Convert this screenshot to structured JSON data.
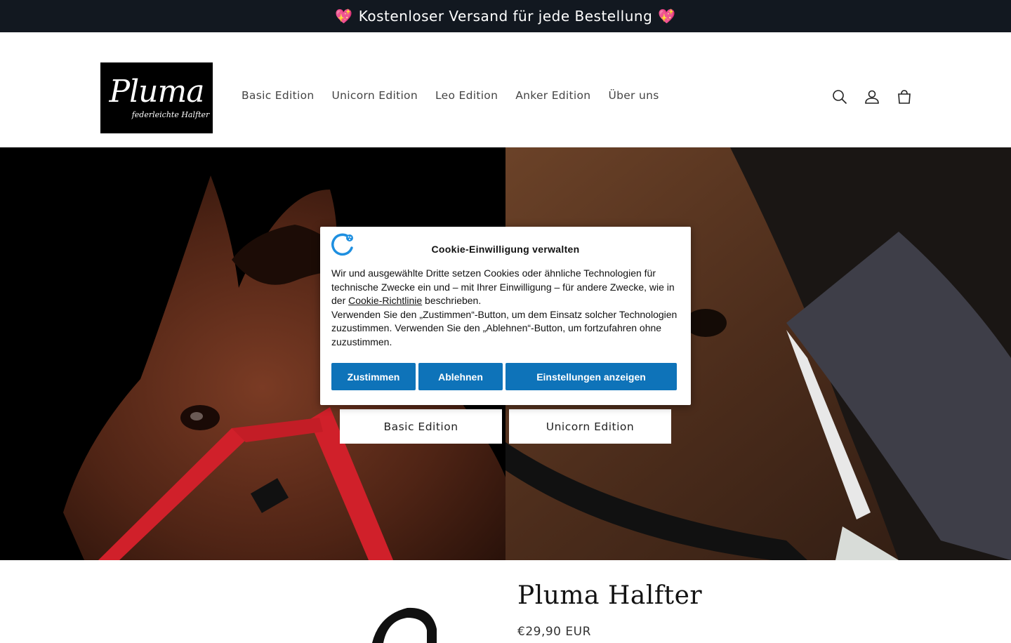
{
  "announcement": {
    "text": "Kostenloser Versand für jede Bestellung",
    "emoji": "💖"
  },
  "logo": {
    "main": "Pluma",
    "sub": "federleichte Halfter"
  },
  "nav": {
    "items": [
      "Basic Edition",
      "Unicorn Edition",
      "Leo Edition",
      "Anker Edition",
      "Über uns"
    ]
  },
  "hero": {
    "heading_line1": "",
    "heading_line2": "",
    "buttons": [
      "Basic Edition",
      "Unicorn Edition"
    ]
  },
  "cookie": {
    "title": "Cookie-Einwilligung verwalten",
    "body_part1": "Wir und ausgewählte Dritte setzen Cookies oder ähnliche Technologien für technische Zwecke ein und – mit Ihrer Einwilligung – für andere Zwecke, wie in der ",
    "link": "Cookie-Richtlinie",
    "body_part2": " beschrieben.",
    "body_part3": "Verwenden Sie den „Zustimmen“-Button, um dem Einsatz solcher Technologien zuzustimmen. Verwenden Sie den „Ablehnen“-Button, um fortzufahren ohne zuzustimmen.",
    "accept": "Zustimmen",
    "reject": "Ablehnen",
    "settings": "Einstellungen anzeigen"
  },
  "product": {
    "title": "Pluma Halfter",
    "price": "€29,90 EUR"
  },
  "colors": {
    "announcement_bg": "#121820",
    "cookie_button": "#0e73b9",
    "halter_red": "#d0202a"
  },
  "icons": {
    "search": "search-icon",
    "account": "account-icon",
    "cart": "cart-icon"
  }
}
